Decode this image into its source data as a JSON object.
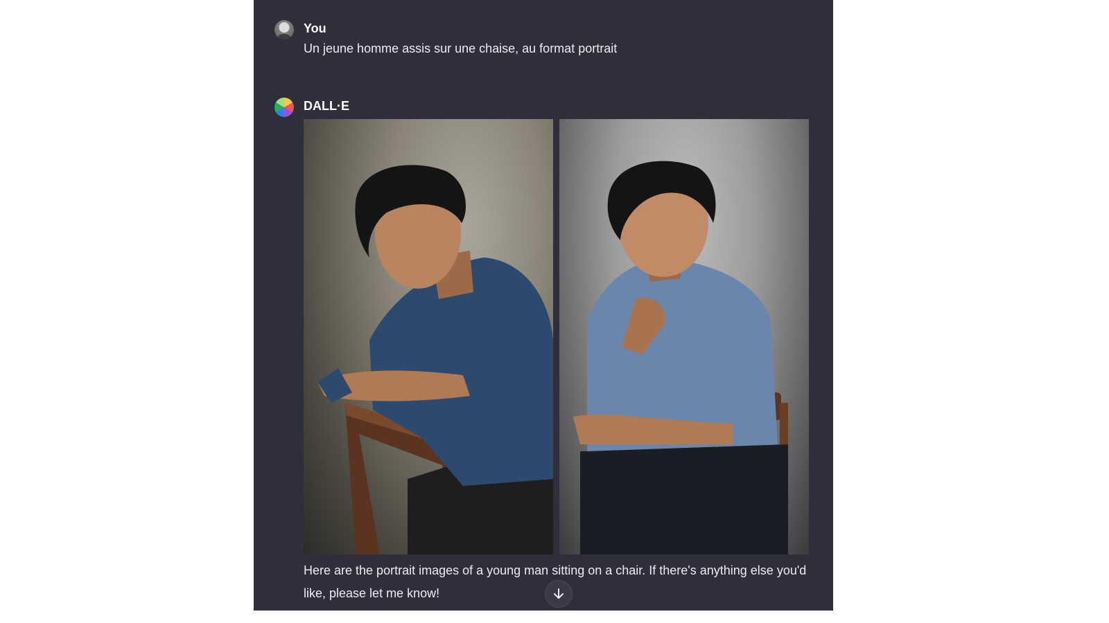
{
  "conversation": {
    "user": {
      "name": "You",
      "message": "Un jeune homme assis sur une chaise, au format portrait"
    },
    "assistant": {
      "name": "DALL·E",
      "message": "Here are the portrait images of a young man sitting on a chair. If there's anything else you'd like, please let me know!",
      "images": [
        {
          "content": "young man in dark blue shirt sitting sideways on a wooden chair"
        },
        {
          "content": "young man in light blue shirt sitting on a wooden chair, hand on chin"
        }
      ]
    }
  },
  "icons": {
    "scroll_down": "arrow-down-icon",
    "user_avatar": "user-avatar",
    "assistant_avatar": "dalle-avatar"
  },
  "colors": {
    "panel_background": "#2f2f3b",
    "text": "#ececf1",
    "page_background": "#ffffff"
  }
}
